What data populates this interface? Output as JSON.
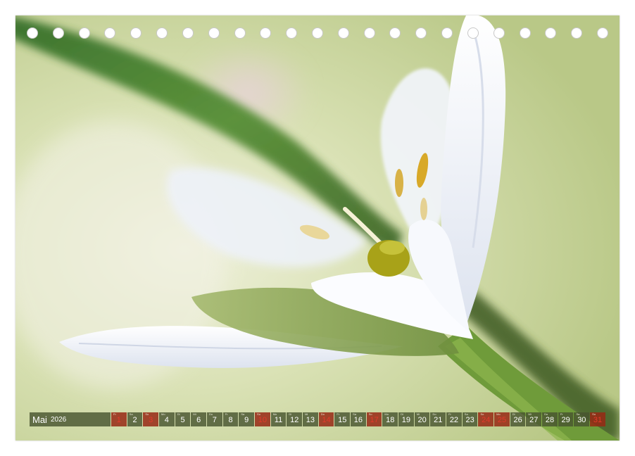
{
  "calendar": {
    "month": "Mai",
    "year": "2026",
    "days": [
      {
        "num": "1",
        "abbr": "Fr",
        "holiday": true
      },
      {
        "num": "2",
        "abbr": "Sa"
      },
      {
        "num": "3",
        "abbr": "So",
        "holiday": true
      },
      {
        "num": "4",
        "abbr": "Mo"
      },
      {
        "num": "5",
        "abbr": "Di"
      },
      {
        "num": "6",
        "abbr": "Mi"
      },
      {
        "num": "7",
        "abbr": "Do"
      },
      {
        "num": "8",
        "abbr": "Fr"
      },
      {
        "num": "9",
        "abbr": "Sa"
      },
      {
        "num": "10",
        "abbr": "So",
        "holiday": true
      },
      {
        "num": "11",
        "abbr": "Mo"
      },
      {
        "num": "12",
        "abbr": "Di"
      },
      {
        "num": "13",
        "abbr": "Mi"
      },
      {
        "num": "14",
        "abbr": "Do",
        "holiday": true
      },
      {
        "num": "15",
        "abbr": "Fr"
      },
      {
        "num": "16",
        "abbr": "Sa"
      },
      {
        "num": "17",
        "abbr": "So",
        "holiday": true
      },
      {
        "num": "18",
        "abbr": "Mo"
      },
      {
        "num": "19",
        "abbr": "Di"
      },
      {
        "num": "20",
        "abbr": "Mi"
      },
      {
        "num": "21",
        "abbr": "Do"
      },
      {
        "num": "22",
        "abbr": "Fr"
      },
      {
        "num": "23",
        "abbr": "Sa"
      },
      {
        "num": "24",
        "abbr": "So",
        "holiday": true
      },
      {
        "num": "25",
        "abbr": "Mo",
        "holiday": true
      },
      {
        "num": "26",
        "abbr": "Di"
      },
      {
        "num": "27",
        "abbr": "Mi"
      },
      {
        "num": "28",
        "abbr": "Do"
      },
      {
        "num": "29",
        "abbr": "Fr"
      },
      {
        "num": "30",
        "abbr": "Sa"
      },
      {
        "num": "31",
        "abbr": "So",
        "holiday": true
      }
    ]
  },
  "colors": {
    "background_green": "#ccd7a0",
    "holiday_red": "#e23a2a",
    "bar": "#485430"
  },
  "holes_count": 23
}
